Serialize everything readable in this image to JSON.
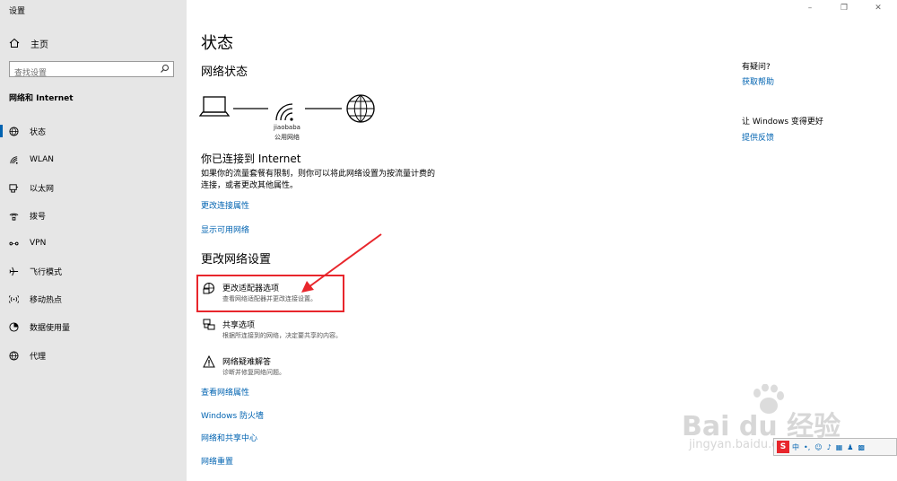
{
  "window": {
    "title": "设置",
    "minimize": "–",
    "maximize": "❐",
    "close": "✕"
  },
  "sidebar": {
    "home_label": "主页",
    "search_placeholder": "查找设置",
    "section_title": "网络和 Internet",
    "items": [
      {
        "label": "状态",
        "icon": "status-globe-icon",
        "active": true
      },
      {
        "label": "WLAN",
        "icon": "wifi-icon"
      },
      {
        "label": "以太网",
        "icon": "ethernet-icon"
      },
      {
        "label": "拨号",
        "icon": "dialup-icon"
      },
      {
        "label": "VPN",
        "icon": "vpn-icon"
      },
      {
        "label": "飞行模式",
        "icon": "airplane-icon"
      },
      {
        "label": "移动热点",
        "icon": "hotspot-icon"
      },
      {
        "label": "数据使用量",
        "icon": "data-usage-icon"
      },
      {
        "label": "代理",
        "icon": "proxy-globe-icon"
      }
    ]
  },
  "main": {
    "page_title": "状态",
    "network_status_heading": "网络状态",
    "network_name": "jiaobaba",
    "network_type": "公用网络",
    "connected_heading": "你已连接到 Internet",
    "connected_desc_line1": "如果你的流量套餐有限制，则你可以将此网络设置为按流量计费的",
    "connected_desc_line2": "连接，或者更改其他属性。",
    "link_change_connection": "更改连接属性",
    "link_show_networks": "显示可用网络",
    "change_settings_heading": "更改网络设置",
    "options": [
      {
        "label": "更改适配器选项",
        "desc": "查看网络适配器并更改连接设置。",
        "icon": "adapter-icon"
      },
      {
        "label": "共享选项",
        "desc": "根据所连接到的网络，决定要共享的内容。",
        "icon": "sharing-icon"
      },
      {
        "label": "网络疑难解答",
        "desc": "诊断并修复网络问题。",
        "icon": "warning-icon"
      }
    ],
    "link_view_properties": "查看网络属性",
    "link_firewall": "Windows 防火墙",
    "link_sharing_center": "网络和共享中心",
    "link_reset": "网络重置"
  },
  "right_panel": {
    "question_heading": "有疑问?",
    "get_help": "获取帮助",
    "improve_heading": "让 Windows 变得更好",
    "feedback": "提供反馈"
  },
  "overlay": {
    "ime_label": "中",
    "watermark_main": "Bai du 经验",
    "watermark_sub": "jingyan.baidu.com"
  },
  "colors": {
    "accent": "#0063b1",
    "annotation_red": "#e8262c",
    "sidebar_bg": "#e6e6e6"
  }
}
